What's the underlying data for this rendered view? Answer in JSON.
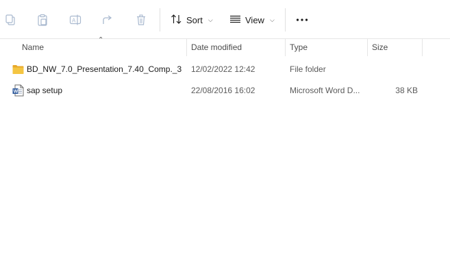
{
  "toolbar": {
    "icons": [
      "copy-icon",
      "paste-icon",
      "rename-icon",
      "share-icon",
      "delete-icon"
    ],
    "sort_label": "Sort",
    "view_label": "View",
    "more_label": "•••"
  },
  "columns": {
    "name": "Name",
    "date": "Date modified",
    "type": "Type",
    "size": "Size"
  },
  "files": [
    {
      "name": "BD_NW_7.0_Presentation_7.40_Comp._3_",
      "date": "12/02/2022 12:42",
      "type": "File folder",
      "size": "",
      "icon": "folder-icon"
    },
    {
      "name": "sap setup",
      "date": "22/08/2016 16:02",
      "type": "Microsoft Word D...",
      "size": "38 KB",
      "icon": "word-document-icon"
    }
  ],
  "colors": {
    "folder": "#f4c542",
    "word_blue": "#2b579a",
    "disabled_icon": "#a9b9cf"
  }
}
